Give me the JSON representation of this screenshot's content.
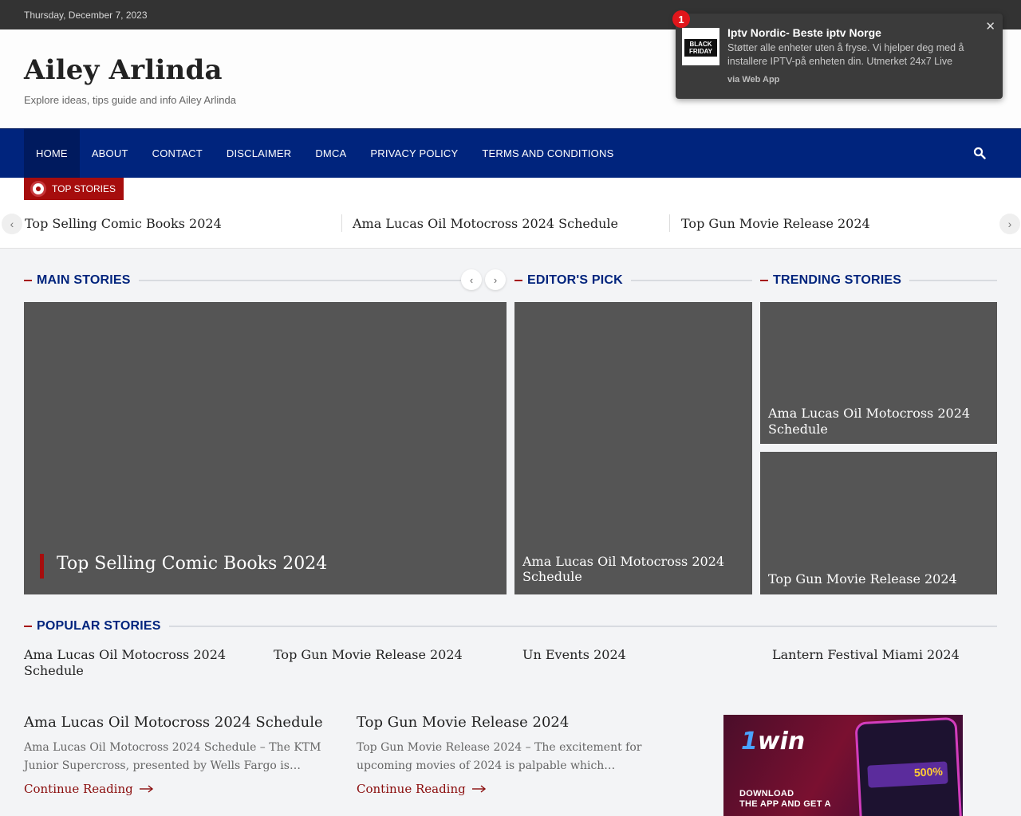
{
  "topbar": {
    "date": "Thursday, December 7, 2023"
  },
  "site": {
    "title": "Ailey Arlinda",
    "tagline": "Explore ideas, tips guide and info Ailey Arlinda"
  },
  "nav": {
    "items": [
      "HOME",
      "ABOUT",
      "CONTACT",
      "DISCLAIMER",
      "DMCA",
      "PRIVACY POLICY",
      "TERMS AND CONDITIONS"
    ],
    "active": "HOME",
    "search_icon": "search-icon"
  },
  "ticker": {
    "badge": "TOP STORIES",
    "items": [
      "Top Selling Comic Books 2024",
      "Ama Lucas Oil Motocross 2024 Schedule",
      "Top Gun Movie Release 2024"
    ],
    "prev_icon": "chevron-left-icon",
    "next_icon": "chevron-right-icon"
  },
  "sections": {
    "main_stories": "MAIN STORIES",
    "editors_pick": "EDITOR'S PICK",
    "trending_stories": "TRENDING STORIES",
    "popular_stories": "POPULAR STORIES"
  },
  "main_story": {
    "title": "Top Selling Comic Books 2024"
  },
  "editors_pick": {
    "title": "Ama Lucas Oil Motocross 2024 Schedule"
  },
  "trending": [
    {
      "title": "Ama Lucas Oil Motocross 2024 Schedule"
    },
    {
      "title": "Top Gun Movie Release 2024"
    }
  ],
  "popular": [
    {
      "title": "Ama Lucas Oil Motocross 2024 Schedule"
    },
    {
      "title": "Top Gun Movie Release 2024"
    },
    {
      "title": "Un Events 2024"
    },
    {
      "title": "Lantern Festival Miami 2024"
    }
  ],
  "posts": [
    {
      "title": "Ama Lucas Oil Motocross 2024 Schedule",
      "excerpt": "Ama Lucas Oil Motocross 2024 Schedule – The KTM Junior Supercross, presented by Wells Fargo is…",
      "link": "Continue Reading"
    },
    {
      "title": "Top Gun Movie Release 2024",
      "excerpt": "Top Gun Movie Release 2024 – The excitement for upcoming movies of 2024 is palpable which…",
      "link": "Continue Reading"
    }
  ],
  "ad": {
    "logo_main": "1",
    "logo_rest": "win",
    "line1": "DOWNLOAD",
    "line2": "THE APP AND GET A",
    "promo_value": "500%"
  },
  "notification": {
    "badge_count": "1",
    "thumb_text": "BLACK FRIDAY",
    "title": "Iptv Nordic- Beste iptv Norge",
    "body": "Støtter alle enheter uten å fryse. Vi hjelper deg med å installere IPTV-på enheten din. Utmerket 24x7 Live",
    "via": "via Web App",
    "close_icon": "close-icon"
  },
  "colors": {
    "nav_bg": "#00247d",
    "accent_red": "#a60d0d",
    "card_bg": "#555555",
    "topbar_bg": "#333333"
  }
}
